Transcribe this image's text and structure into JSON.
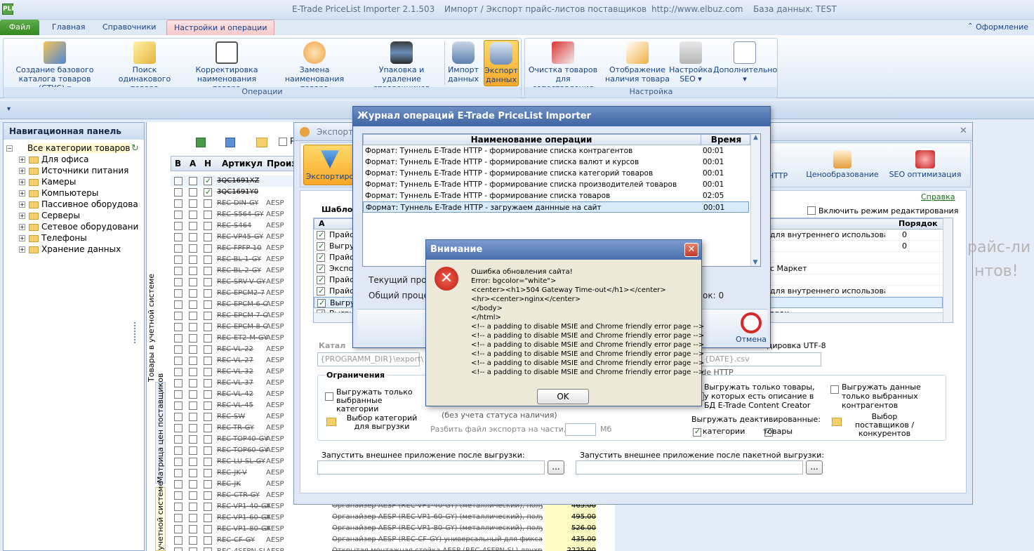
{
  "titlebar": {
    "app_name": "E-Trade PriceList Importer 2.1.503",
    "subtitle": "Импорт / Экспорт прайс-листов поставщиков",
    "url": "http://www.elbuz.com",
    "db": "База данных: TEST",
    "app_icon_label": "PLI"
  },
  "tabs": {
    "file": "Файл",
    "main": "Главная",
    "refs": "Справочники",
    "settings": "Настройки и операции",
    "design": "Оформление"
  },
  "ribbon": {
    "ops": [
      {
        "label1": "Создание базового",
        "label2": "каталога товаров (СТУС)"
      },
      {
        "label1": "Поиск одинакового",
        "label2": "товара"
      },
      {
        "label1": "Корректировка",
        "label2": "наименования товара"
      },
      {
        "label1": "Замена наименования",
        "label2": "товара"
      },
      {
        "label1": "Упаковка и удаление",
        "label2": "справочников"
      },
      {
        "label1": "Импорт",
        "label2": "данных"
      },
      {
        "label1": "Экспорт",
        "label2": "данных"
      }
    ],
    "ops_caption": "Операции",
    "setup": [
      {
        "label1": "Очистка товаров",
        "label2": "для сопоставления"
      },
      {
        "label1": "Отображение",
        "label2": "наличия товара"
      },
      {
        "label1": "Настройка",
        "label2": "SEO"
      },
      {
        "label1": "Дополнительно",
        "label2": ""
      }
    ],
    "setup_caption": "Настройка"
  },
  "nav": {
    "title": "Навигационная панель",
    "items": [
      "Все категории товаров",
      "Для офиса",
      "Источники питания",
      "Камеры",
      "Компьютеры",
      "Пассивное оборудова",
      "Серверы",
      "Сетевое оборудовани",
      "Телефоны",
      "Хранение данных"
    ]
  },
  "grid": {
    "headers": [
      "В",
      "А",
      "Н",
      "Артикул",
      "Произ"
    ],
    "vlabel1": "Товары в учетной системе",
    "vlabel2": "Матрица цен поставщиков",
    "vlabel3": "учетной системе",
    "rows": [
      "3QC1691XZ",
      "3QC1691Y0",
      "REC-DIN-GY",
      "REC-S564-GY",
      "REC-S464",
      "REC-VP45-GY",
      "REC-FPFP-10",
      "REC-BL-1-GY",
      "REC-BL-2-GY",
      "REC-SRV-V-GY",
      "REC-EPCM2-7",
      "REC-EPCM-6-C",
      "REC-EPCM-7-C",
      "REC-EPCM-8-C",
      "REC-ET2-M-GY",
      "REC-VL-22",
      "REC-VL-27",
      "REC-VL-32",
      "REC-VL-37",
      "REC-VL-42",
      "REC-VL-45",
      "REC-SW",
      "REC-TR-GY",
      "REC-TOP40-GY",
      "REC-TOP60-GY",
      "REC-LU-SL-GY",
      "REC-JK-V",
      "REC-JK",
      "REC-CTR-GY",
      "REC-VP1-40-GY",
      "REC-VP1-60-GY",
      "REC-VP1-80-GY",
      "REC-CF-GY",
      "REC-4SFPN-SL"
    ],
    "maker": "AESP",
    "bottom_rows": [
      {
        "name": "Органайзер AESP (REC-VP1-40-GY) (металлический), полуко",
        "price": "465.00"
      },
      {
        "name": "Органайзер AESP (REC-VP1-60-GY) (металлический), полуко",
        "price": "495.00"
      },
      {
        "name": "Органайзер AESP (REC-VP1-80-GY) (металлический), полуко",
        "price": "526.00"
      },
      {
        "name": "Органайзер AESP (REC-CF-GY) универсальный для фиксац",
        "price": "435.00"
      },
      {
        "name": "Открытая монтажная стойка AESP (REC-4SFPN-SL) двухр",
        "price": "2225.00"
      }
    ]
  },
  "exportwin": {
    "title": "Экспорт",
    "toolbar_left": "Экспортиро",
    "toolbar": [
      "а HTTP",
      "Ценообразование",
      "SEO оптимизация"
    ],
    "help": "Справка",
    "edit_mode": "Включить режим редактирования",
    "templates_label": "Шаблон",
    "col_a": "А",
    "col_order": "Порядок",
    "template_rows": [
      {
        "left": "Прайс",
        "right": "для внутреннего использования",
        "order": "0"
      },
      {
        "left": "Выгру",
        "right": "",
        "order": "0"
      },
      {
        "left": "Прайс",
        "right": "",
        "order": ""
      },
      {
        "left": "Экспор",
        "right": "с Маркет",
        "order": ""
      },
      {
        "left": "Прайс",
        "right": "",
        "order": ""
      },
      {
        "left": "Прайс",
        "right": "для внутреннего использования",
        "order": ""
      },
      {
        "left": "Выгру",
        "right": "",
        "order": ""
      },
      {
        "left": "Выгру",
        "right": "арах",
        "order": ""
      }
    ],
    "catalog_label": "Катал",
    "catalog_path": "{PROGRAMM_DIR}\\export\\",
    "file_name": "s_{DATE}.csv",
    "encoding": "одировка UTF-8",
    "tunnel": "rade HTTP",
    "limits": "Ограничения",
    "only_selected_cats": "Выгружать только выбранные категории",
    "pick_cats": "Выбор категорий для выгрузки",
    "no_status": "(без учета статуса наличия)",
    "split": "Разбить файл экспорта на части, по:",
    "mb": "Мб",
    "only_desc": "Выгружать только товары, у которых есть описание в БД E-Trade Content Creator",
    "only_selected_contr": "Выгружать данные только выбранных контрагентов",
    "deactivated": "Выгружать деактивированные:",
    "cats": "категории",
    "goods": "товары",
    "pick_suppliers": "Выбор поставщиков / конкурентов",
    "ext_app": "Запустить внешнее приложение после выгрузки:",
    "ext_app_batch": "Запустить внешнее приложение после пакетной выгрузки:",
    "dots": "...",
    "bg_text1": "райс-ли",
    "bg_text2": "нтов!"
  },
  "journal": {
    "title": "Журнал операций E-Trade PriceList Importer",
    "col_name": "Наименование операции",
    "col_time": "Время",
    "rows": [
      {
        "name": "Формат: Туннель E-Trade HTTP - формирование списка контрагентов",
        "time": "00:01"
      },
      {
        "name": "Формат: Туннель E-Trade HTTP - формирование списка валют и курсов",
        "time": "00:01"
      },
      {
        "name": "Формат: Туннель E-Trade HTTP - формирование списка категорий товаров",
        "time": "00:01"
      },
      {
        "name": "Формат: Туннель E-Trade HTTP - формирование списка производителей товаров",
        "time": "00:01"
      },
      {
        "name": "Формат: Туннель E-Trade HTTP - формирование списка товаров",
        "time": "02:05"
      },
      {
        "name": "Формат: Туннель E-Trade HTTP - загружаем даннные на сайт",
        "time": "00:01"
      }
    ],
    "current": "Текущий проц",
    "total": "Общий процес",
    "ok_count": "ок: 0",
    "cancel": "Отмена"
  },
  "alert": {
    "title": "Внимание",
    "lines": [
      "Ошибка обновления сайта!",
      "Error: bgcolor=\"white\">",
      "<center><h1>504 Gateway Time-out</h1></center>",
      "<hr><center>nginx</center>",
      "</body>",
      "</html>",
      "<!-- a padding to disable MSIE and Chrome friendly error page -->",
      "<!-- a padding to disable MSIE and Chrome friendly error page -->",
      "<!-- a padding to disable MSIE and Chrome friendly error page -->",
      "<!-- a padding to disable MSIE and Chrome friendly error page -->",
      "<!-- a padding to disable MSIE and Chrome friendly error page -->",
      "<!-- a padding to disable MSIE and Chrome friendly error page -->"
    ],
    "ok": "OK"
  }
}
